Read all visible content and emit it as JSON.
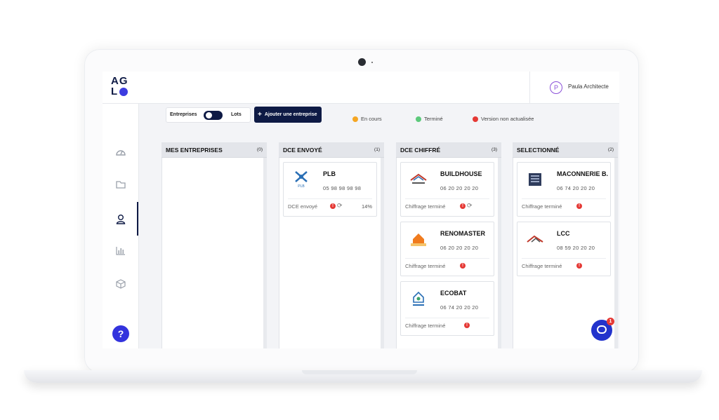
{
  "app": {
    "logo_line1": "AG",
    "logo_line2": "L",
    "user_initial": "P",
    "user_name": "Paula Architecte"
  },
  "toolbar": {
    "toggle_left": "Entreprises",
    "toggle_right": "Lots",
    "add_button": "Ajouter une entreprise"
  },
  "legend": [
    {
      "label": "En cours",
      "color": "#f5a623"
    },
    {
      "label": "Terminé",
      "color": "#5cc97b"
    },
    {
      "label": "Version non actualisée",
      "color": "#e53935"
    }
  ],
  "columns": [
    {
      "title": "MES ENTREPRISES",
      "count": "(0)",
      "cards": []
    },
    {
      "title": "DCE ENVOYÉ",
      "count": "(1)",
      "cards": [
        {
          "name": "PLB",
          "phone": "05 98 98 98 98",
          "status": "DCE envoyé",
          "percent": "14%",
          "logo": "plb-logo",
          "sync": true
        }
      ]
    },
    {
      "title": "DCE CHIFFRÉ",
      "count": "(3)",
      "cards": [
        {
          "name": "BUILDHOUSE",
          "phone": "06 20 20 20 20",
          "status": "Chiffrage terminé",
          "logo": "buildhouse-logo",
          "sync": true
        },
        {
          "name": "RENOMASTER",
          "phone": "06 20 20 20 20",
          "status": "Chiffrage terminé",
          "logo": "renomaster-logo",
          "sync": false
        },
        {
          "name": "ECOBAT",
          "phone": "06 74 20 20 20",
          "status": "Chiffrage terminé",
          "logo": "ecobat-logo",
          "sync": false
        }
      ]
    },
    {
      "title": "SELECTIONNÉ",
      "count": "(2)",
      "cards": [
        {
          "name": "MACONNERIE B.",
          "phone": "06 74 20 20 20",
          "status": "Chiffrage terminé",
          "logo": "maconnerie-logo",
          "sync": false
        },
        {
          "name": "LCC",
          "phone": "08 59 20 20 20",
          "status": "Chiffrage terminé",
          "logo": "lcc-logo",
          "sync": false
        }
      ]
    }
  ],
  "chat_badge": "1",
  "help_label": "?"
}
